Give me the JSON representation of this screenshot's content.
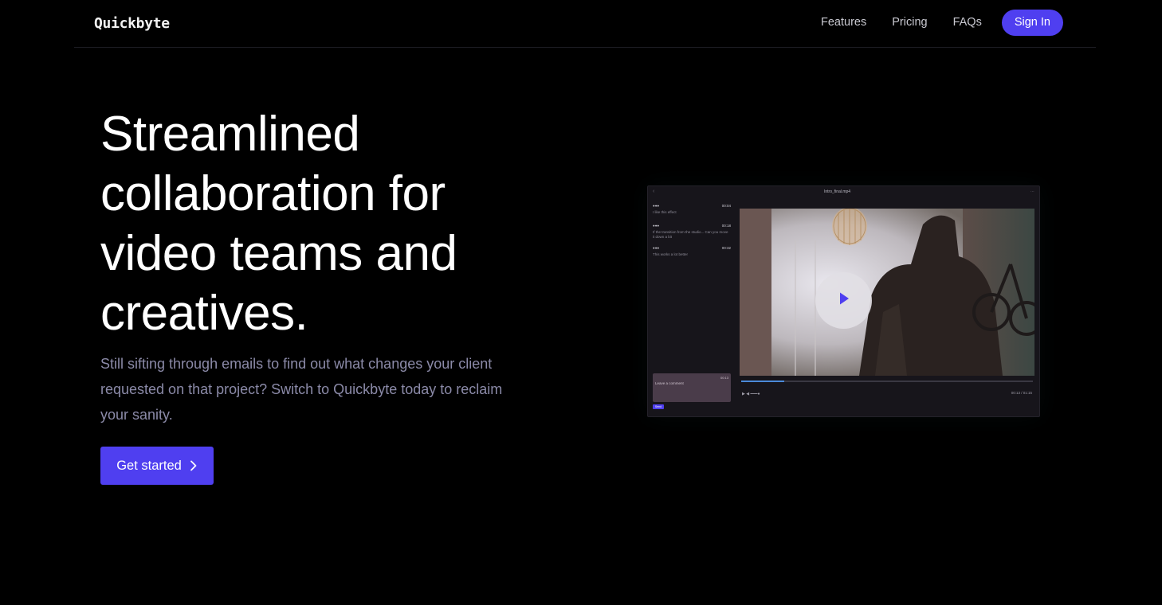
{
  "nav": {
    "logo": "Quickbyte",
    "links": [
      "Features",
      "Pricing",
      "FAQs"
    ],
    "signin": "Sign In"
  },
  "hero": {
    "title_lines": [
      "Streamlined",
      "collaboration for",
      "video teams and",
      "creatives."
    ],
    "subtitle_lines": [
      "Still sifting through emails to find out what changes your client",
      "requested on that project? Switch to Quickbyte today to reclaim",
      "your sanity."
    ],
    "cta": "Get started"
  },
  "preview": {
    "file_name": "Intro_final.mp4",
    "comments": [
      {
        "time": "00:04",
        "body": "I like this effect"
      },
      {
        "time": "00:18",
        "body": "If the transition from the studio... Can you move it down a bit"
      },
      {
        "time": "00:32",
        "body": "This works a lot better"
      }
    ],
    "composer_placeholder": "Leave a comment",
    "composer_timestamp": "00:13",
    "send_label": "Send",
    "player_time": "00:13 / 01:15"
  },
  "colors": {
    "accent": "#4f3ff0",
    "background": "#000000",
    "subtitle": "#8b8aa8"
  },
  "icons": [
    "chevron-right-icon",
    "play-icon",
    "back-arrow-icon"
  ]
}
